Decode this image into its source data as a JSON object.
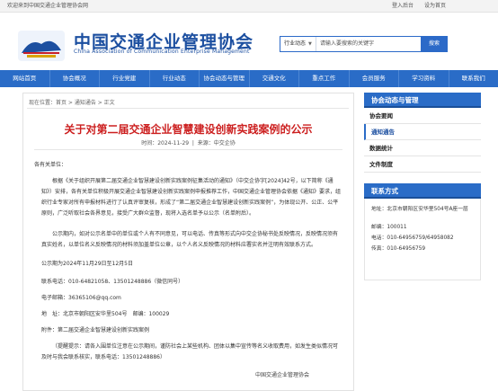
{
  "topbar": {
    "welcome": "欢迎来到中国交通企业管理协会网",
    "login": "登入后台",
    "favorite": "设为首页"
  },
  "header": {
    "title": "中国交通企业管理协会",
    "subtitle": "China Association of Communication Enterprise Management",
    "search_select": "行业动态",
    "search_placeholder": "请输入要搜索的关键字",
    "search_button": "搜索"
  },
  "nav": [
    "网站首页",
    "协会概况",
    "行业党建",
    "行业动态",
    "协会动态与管理",
    "交通文化",
    "重点工作",
    "会员服务",
    "学习资料",
    "联系我们"
  ],
  "breadcrumb": "现在位置：首页 > 通知通告 > 正文",
  "article": {
    "title": "关于对第二届交通企业智慧建设创新实践案例的公示",
    "date_label": "时间：",
    "date": "2024-11-29",
    "source_label": "来源：",
    "source": "中交企协",
    "greeting": "各有关单位：",
    "p1": "根据《关于组织开展第二届交通企业智慧建设创新实践案例征集活动的通知》（中交企协字[2024]42号，以下简称《通知》）安排，各有关单位积极开展交通企业智慧建设创新实践案例申报推荐工作，中国交通企业管理协会依据《通知》要求，组织行业专家对所有申报材料进行了认真评审复核，形成了“第二届交通企业智慧建设创新实践案例”，为体现公开、公正、公平原则，广泛听取社会各界意见，接受广大群众监督，现将入选名单予以公示（名单附后）。",
    "p2": "公示期内，如对公示名单中的单位或个人有不同意见，可以电话、传真等形式向中交企协秘书处反映情况，反映情况须有真实姓名，以单位名义反映情况的材料须加盖单位公章，以个人名义反映情况的材料应署实名并注明有效联系方式。",
    "p3": "公示期为2024年11月29日至12月5日",
    "contacts": [
      {
        "label": "联系电话：",
        "value": "010-64821058、13501248886（微信同号）"
      },
      {
        "label": "电子邮箱：",
        "value": "36365106@qq.com"
      },
      {
        "label": "地　址：",
        "value": "北京市朝阳区安华里504号　邮编：100029"
      }
    ],
    "attachment": "附件：第二届交通企业智慧建设创新实践案例",
    "p4": "（提醒提示：请各入围单位注意在公示期间，谨防社会上某些机构、团体以集中宣传等名义收取费用，如发生类似情况可及时与我会联系核实，联系电话：13501248886）",
    "footer": "中国交通企业管理协会"
  },
  "sidebar": {
    "section_title": "协会动态与管理",
    "items": [
      "协会要闻",
      "通知通告",
      "数据统计",
      "文件制度"
    ],
    "active_index": 1,
    "contact_title": "联系方式",
    "address_label": "地址：",
    "address": "北京市朝阳区安华里504号A座一层",
    "zip_label": "邮编：",
    "zip": "100011",
    "phone_label": "电话：",
    "phone": "010-64956759/64958082",
    "fax_label": "传真：",
    "fax": "010-64956759"
  },
  "colors": {
    "nav": "#2a6cc7",
    "title_red": "#cc1f1f",
    "brand_blue": "#1c4fa0"
  }
}
